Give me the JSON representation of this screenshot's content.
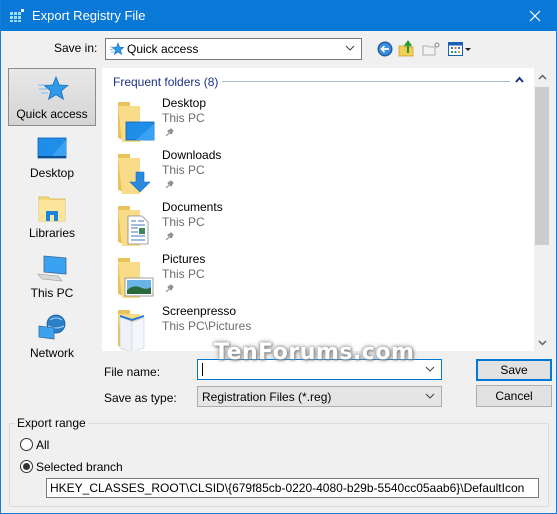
{
  "window": {
    "title": "Export Registry File"
  },
  "toolbar": {
    "save_in_label": "Save in:",
    "save_in_value": "Quick access",
    "buttons": [
      {
        "name": "back",
        "icon": "back-arrow-icon"
      },
      {
        "name": "up-one-level",
        "icon": "folder-up-icon"
      },
      {
        "name": "create-new-folder",
        "icon": "new-folder-icon"
      },
      {
        "name": "view-menu",
        "icon": "view-menu-icon"
      }
    ]
  },
  "places": [
    {
      "label": "Quick access",
      "icon": "star-icon",
      "active": true
    },
    {
      "label": "Desktop",
      "icon": "desktop-icon"
    },
    {
      "label": "Libraries",
      "icon": "libraries-icon"
    },
    {
      "label": "This PC",
      "icon": "computer-icon"
    },
    {
      "label": "Network",
      "icon": "network-icon"
    }
  ],
  "list": {
    "group_header": "Frequent folders (8)",
    "items": [
      {
        "name": "Desktop",
        "location": "This PC",
        "pinned": true,
        "icon": "desktop-folder-icon"
      },
      {
        "name": "Downloads",
        "location": "This PC",
        "pinned": true,
        "icon": "downloads-folder-icon"
      },
      {
        "name": "Documents",
        "location": "This PC",
        "pinned": true,
        "icon": "documents-folder-icon"
      },
      {
        "name": "Pictures",
        "location": "This PC",
        "pinned": true,
        "icon": "pictures-folder-icon"
      },
      {
        "name": "Screenpresso",
        "location": "This PC\\Pictures",
        "pinned": false,
        "icon": "screenpresso-folder-icon"
      }
    ]
  },
  "form": {
    "file_name_label": "File name:",
    "file_name_value": "",
    "save_as_type_label": "Save as type:",
    "save_as_type_value": "Registration Files (*.reg)",
    "save_button": "Save",
    "cancel_button": "Cancel"
  },
  "watermark": "TenForums.com",
  "export_range": {
    "title": "Export range",
    "options": [
      {
        "label": "All",
        "checked": false
      },
      {
        "label": "Selected branch",
        "checked": true
      }
    ],
    "branch_value": "HKEY_CLASSES_ROOT\\CLSID\\{679f85cb-0220-4080-b29b-5540cc05aab6}\\DefaultIcon"
  }
}
